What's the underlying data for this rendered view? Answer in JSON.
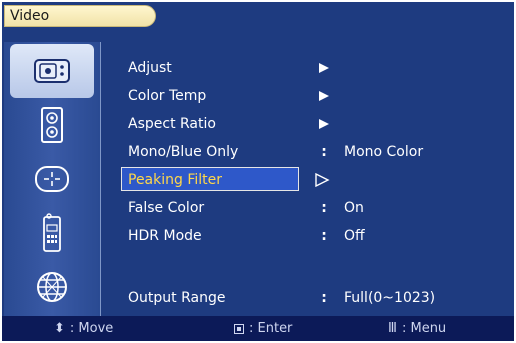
{
  "title": "Video",
  "sidebar": {
    "items": [
      {
        "icon": "video-icon",
        "active": true
      },
      {
        "icon": "audio-speaker-icon",
        "active": false
      },
      {
        "icon": "position-crosshair-icon",
        "active": false
      },
      {
        "icon": "remote-control-icon",
        "active": false
      },
      {
        "icon": "globe-language-icon",
        "active": false
      }
    ]
  },
  "menu": {
    "items": [
      {
        "label": "Adjust",
        "marker": "arrow",
        "value": ""
      },
      {
        "label": "Color Temp",
        "marker": "arrow",
        "value": ""
      },
      {
        "label": "Aspect Ratio",
        "marker": "arrow",
        "value": ""
      },
      {
        "label": "Mono/Blue Only",
        "marker": ":",
        "value": "Mono Color"
      },
      {
        "label": "Peaking Filter",
        "marker": "selected-arrow",
        "value": ""
      },
      {
        "label": "False Color",
        "marker": ":",
        "value": "On"
      },
      {
        "label": "HDR Mode",
        "marker": ":",
        "value": "Off"
      },
      {
        "label": "Output Range",
        "marker": ":",
        "value": "Full(0~1023)"
      }
    ],
    "selected_index": 4
  },
  "footer": {
    "move": ": Move",
    "enter": ": Enter",
    "menu": ": Menu",
    "menu_glyph": "Ⅲ",
    "move_glyph": "⬍"
  },
  "colors": {
    "background": "#1e3b80",
    "footer": "#0c1a58",
    "selected_text": "#ffd74a",
    "selected_bg": "#2e58c9",
    "title_pill": "#f6ebbf"
  }
}
